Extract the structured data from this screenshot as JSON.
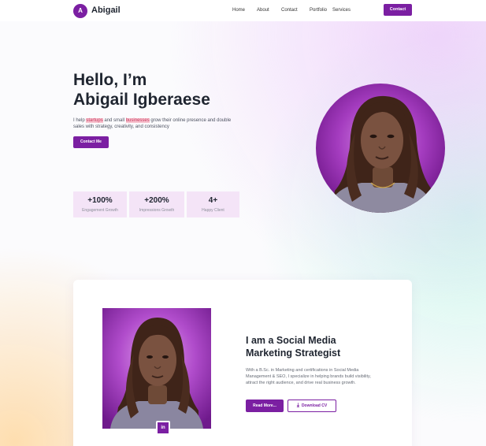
{
  "header": {
    "logo_letter": "A",
    "logo_name": "Abigail",
    "nav": [
      "Home",
      "About",
      "Contact",
      "Portfolio",
      "Services"
    ],
    "cta_label": "Contact"
  },
  "hero": {
    "title_line1": "Hello, I’m",
    "title_line2": "Abigail Igberaese",
    "desc": {
      "t1": "I help ",
      "hl1": "startups",
      "t2": " and small ",
      "hl2": "businesses",
      "t3": " grow their online presence and double sales with strategy, creativity, and consistency"
    },
    "cta_label": "Contact Me",
    "stats": [
      {
        "value": "+100%",
        "label": "Engagement Growth"
      },
      {
        "value": "+200%",
        "label": "Impressions Growth"
      },
      {
        "value": "4+",
        "label": "Happy Client"
      }
    ]
  },
  "about": {
    "title_line1": "I am a Social Media",
    "title_line2": "Marketing Strategist",
    "desc": "With a B.Sc. in Marketing and certifications in Social Media Management & SEO, I specialize in helping brands build visibility, attract the right audience, and drive real business growth.",
    "read_more_label": "Read More...",
    "download_label": "Download CV",
    "linkedin_label": "in"
  },
  "colors": {
    "accent": "#7b1fa2",
    "stat_bg": "#f4e4f7",
    "text_dark": "#1f2530"
  }
}
